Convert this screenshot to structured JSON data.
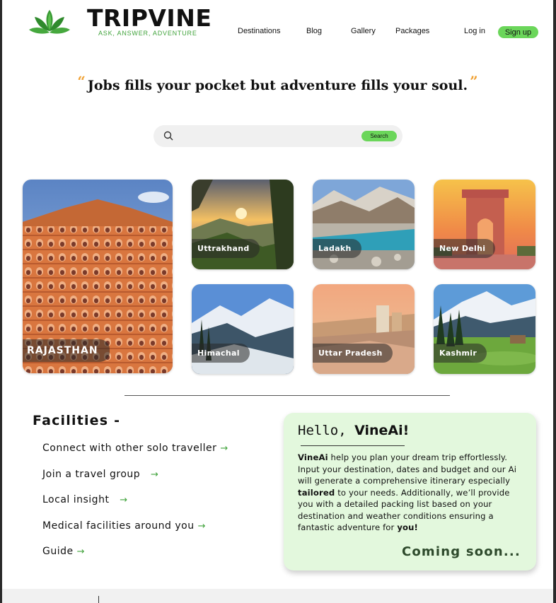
{
  "brand": {
    "name": "TRIPVINE",
    "tagline": "ASK, ANSWER, ADVENTURE"
  },
  "nav": {
    "items": [
      "Destinations",
      "Blog",
      "Gallery",
      "Packages"
    ],
    "login": "Log in",
    "signup": "Sign up"
  },
  "quote": {
    "open_mark": "“",
    "text": "Jobs fills your pocket but adventure fills your soul.",
    "close_mark": "”"
  },
  "search": {
    "placeholder": "",
    "button": "Search"
  },
  "destinations": [
    "RAJASTHAN",
    "Uttrakhand",
    "Ladakh",
    "New Delhi",
    "Himachal",
    "Uttar Pradesh",
    "Kashmir"
  ],
  "facilities": {
    "title": "Facilities -",
    "items": [
      "Connect with other solo traveller",
      "Join a travel group",
      "Local insight",
      "Medical facilities around you",
      "Guide"
    ],
    "arrow": "→"
  },
  "vineai": {
    "hello": "Hello,",
    "name": "VineAi!",
    "p_intro": "VineAi",
    "p_mid": " help you plan your dream trip effortlessly. Input your destination, dates and budget and our Ai will generate a comprehensive itinerary especially ",
    "p_tailored": "tailored",
    "p_end": " to your needs. Additionally, we’ll provide you with a detailed packing list based on your destination and weather conditions ensuring  a fantastic adventure for ",
    "p_you": "you!",
    "coming_soon": "Coming soon..."
  },
  "colors": {
    "accent_green": "#6bd65a",
    "quote_mark": "#f0a133",
    "card_bg": "#e3f8dd"
  }
}
